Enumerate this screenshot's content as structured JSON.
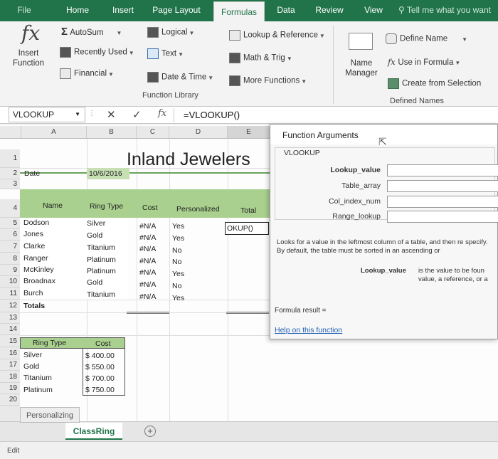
{
  "ribbon_tabs": [
    "File",
    "Home",
    "Insert",
    "Page Layout",
    "Formulas",
    "Data",
    "Review",
    "View"
  ],
  "tell_me": "Tell me what you want",
  "ribbon": {
    "insert_function": "Insert Function",
    "fx_glyph": "fx",
    "autosum": "AutoSum",
    "recently_used": "Recently Used",
    "financial": "Financial",
    "logical": "Logical",
    "text": "Text",
    "date_time": "Date & Time",
    "lookup_reference": "Lookup & Reference",
    "math_trig": "Math & Trig",
    "more_functions": "More Functions",
    "function_library": "Function Library",
    "name_manager": "Name Manager",
    "define_name": "Define Name",
    "use_in_formula": "Use in Formula",
    "create_from_selection": "Create from Selection",
    "defined_names": "Defined Names"
  },
  "formula_bar": {
    "name_box": "VLOOKUP",
    "cancel": "✕",
    "enter": "✓",
    "fx": "fx",
    "formula": "=VLOOKUP()"
  },
  "columns": [
    "A",
    "B",
    "C",
    "D",
    "E"
  ],
  "rows": [
    "1",
    "2",
    "3",
    "4",
    "5",
    "6",
    "7",
    "8",
    "9",
    "10",
    "11",
    "12",
    "13",
    "14",
    "15",
    "16",
    "17",
    "18",
    "19",
    "20"
  ],
  "sheet": {
    "title": "Inland Jewelers",
    "date_label": "Date",
    "date_value": "10/6/2016",
    "headers": {
      "name": "Name",
      "ring_type": "Ring Type",
      "cost": "Cost",
      "personalized": "Personalized",
      "total": "Total"
    },
    "data_rows": [
      {
        "name": "Dodson",
        "ring": "Silver",
        "cost": "#N/A",
        "pers": "Yes",
        "total": "OKUP()"
      },
      {
        "name": "Jones",
        "ring": "Gold",
        "cost": "#N/A",
        "pers": "Yes",
        "total": ""
      },
      {
        "name": "Clarke",
        "ring": "Titanium",
        "cost": "#N/A",
        "pers": "No",
        "total": ""
      },
      {
        "name": "Ranger",
        "ring": "Platinum",
        "cost": "#N/A",
        "pers": "No",
        "total": ""
      },
      {
        "name": "McKinley",
        "ring": "Platinum",
        "cost": "#N/A",
        "pers": "Yes",
        "total": ""
      },
      {
        "name": "Broadnax",
        "ring": "Gold",
        "cost": "#N/A",
        "pers": "No",
        "total": ""
      },
      {
        "name": "Burch",
        "ring": "Titanium",
        "cost": "#N/A",
        "pers": "Yes",
        "total": ""
      }
    ],
    "totals_label": "Totals",
    "lookup_header": {
      "ring_type": "Ring Type",
      "cost": "Cost"
    },
    "lookup_rows": [
      {
        "ring": "Silver",
        "cost": "$ 400.00"
      },
      {
        "ring": "Gold",
        "cost": "$ 550.00"
      },
      {
        "ring": "Titanium",
        "cost": "$ 700.00"
      },
      {
        "ring": "Platinum",
        "cost": "$ 750.00"
      }
    ]
  },
  "dialog": {
    "title": "Function Arguments",
    "function_name": "VLOOKUP",
    "args": [
      "Lookup_value",
      "Table_array",
      "Col_index_num",
      "Range_lookup"
    ],
    "description": "Looks for a value in the leftmost column of a table, and then re specify. By default, the table must be sorted in an ascending or",
    "arg_help_label": "Lookup_value",
    "arg_help_text": "is the value to be foun value, a reference, or a",
    "formula_result": "Formula result =",
    "help_link": "Help on this function"
  },
  "sheet_tabs": [
    "Personalizing",
    "ClassRing"
  ],
  "status": "Edit",
  "colors": {
    "excel_green": "#21744a",
    "header_fill": "#a9d08e",
    "link": "#1f5fb4"
  }
}
